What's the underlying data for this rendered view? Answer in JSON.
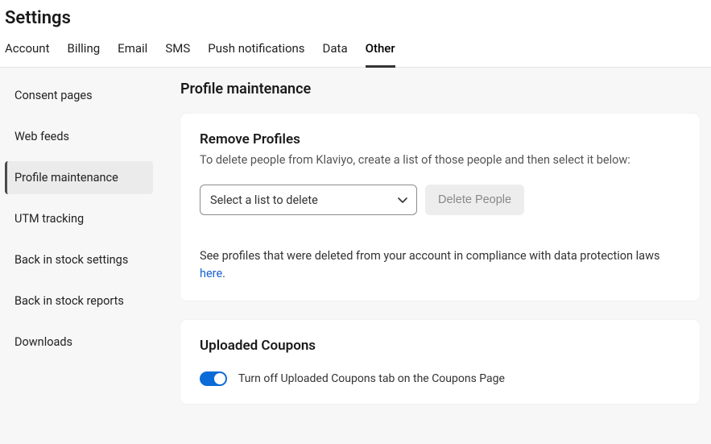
{
  "header": {
    "title": "Settings"
  },
  "topnav": {
    "items": [
      {
        "label": "Account"
      },
      {
        "label": "Billing"
      },
      {
        "label": "Email"
      },
      {
        "label": "SMS"
      },
      {
        "label": "Push notifications"
      },
      {
        "label": "Data"
      },
      {
        "label": "Other"
      }
    ],
    "active_index": 6
  },
  "sidebar": {
    "items": [
      {
        "label": "Consent pages"
      },
      {
        "label": "Web feeds"
      },
      {
        "label": "Profile maintenance"
      },
      {
        "label": "UTM tracking"
      },
      {
        "label": "Back in stock settings"
      },
      {
        "label": "Back in stock reports"
      },
      {
        "label": "Downloads"
      }
    ],
    "active_index": 2
  },
  "main": {
    "title": "Profile maintenance",
    "remove_profiles": {
      "heading": "Remove Profiles",
      "subtext": "To delete people from Klaviyo, create a list of those people and then select it below:",
      "select_placeholder": "Select a list to delete",
      "delete_button": "Delete People",
      "note_prefix": "See profiles that were deleted from your account in compliance with data protection laws ",
      "note_link": "here",
      "note_suffix": "."
    },
    "uploaded_coupons": {
      "heading": "Uploaded Coupons",
      "toggle_label": "Turn off Uploaded Coupons tab on the Coupons Page",
      "toggle_on": true
    }
  }
}
